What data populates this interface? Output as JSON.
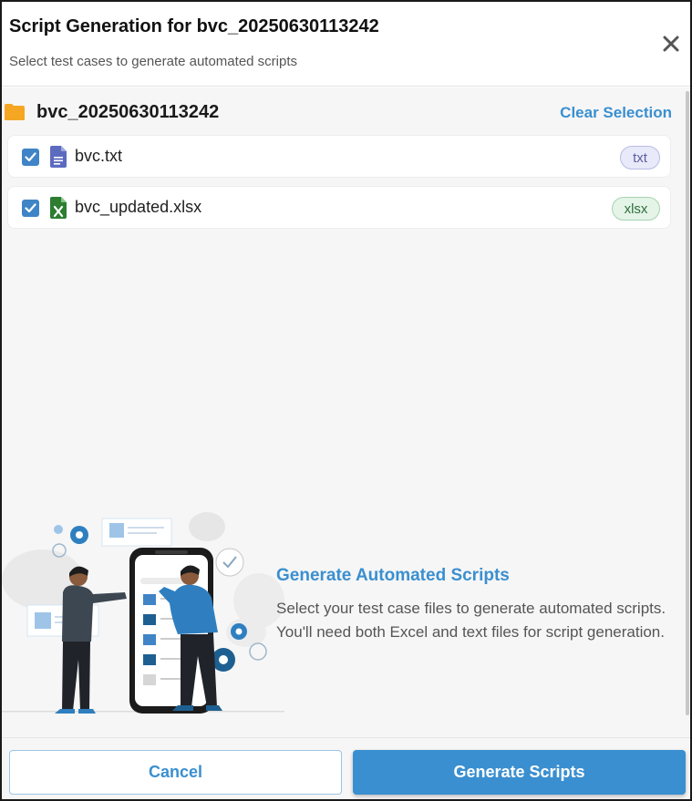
{
  "dialog": {
    "title": "Script Generation for bvc_20250630113242",
    "subtitle": "Select test cases to generate automated scripts",
    "close_icon": "close-icon"
  },
  "folder": {
    "name": "bvc_20250630113242",
    "icon": "folder-icon",
    "clear_label": "Clear Selection"
  },
  "files": [
    {
      "name": "bvc.txt",
      "badge": "txt",
      "checked": true,
      "icon": "text-file-icon"
    },
    {
      "name": "bvc_updated.xlsx",
      "badge": "xlsx",
      "checked": true,
      "icon": "excel-file-icon"
    }
  ],
  "promo": {
    "title": "Generate Automated Scripts",
    "text": "Select your test case files to generate automated scripts. You'll need both Excel and text files for script generation."
  },
  "footer": {
    "cancel_label": "Cancel",
    "generate_label": "Generate Scripts"
  },
  "colors": {
    "accent": "#3a8fd0",
    "folder": "#f5a623",
    "checkbox": "#3f84c6",
    "txt_badge": "#e8e9f9",
    "xlsx_badge": "#e4f4e7"
  }
}
